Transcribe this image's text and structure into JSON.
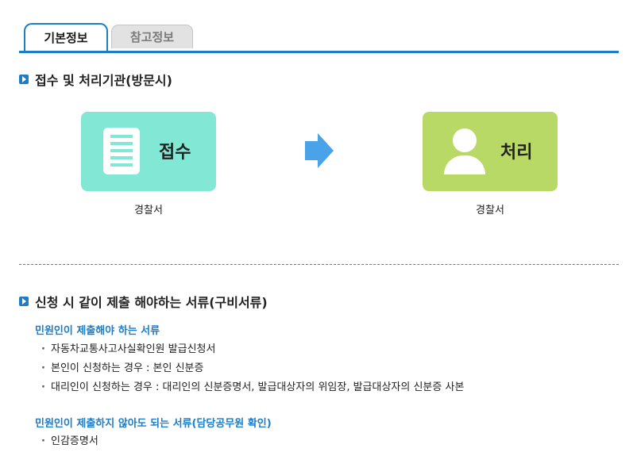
{
  "tabs": [
    {
      "label": "기본정보",
      "active": true
    },
    {
      "label": "참고정보",
      "active": false
    }
  ],
  "section_agency": {
    "title": "접수 및 처리기관(방문시)",
    "receive": {
      "label": "접수",
      "caption": "경찰서",
      "icon": "document-icon",
      "color": "#82e7d5"
    },
    "process": {
      "label": "처리",
      "caption": "경찰서",
      "icon": "person-icon",
      "color": "#b8d965"
    },
    "arrow": {
      "icon": "arrow-right-icon",
      "color": "#4aa3e8"
    }
  },
  "section_docs": {
    "title": "신청 시 같이 제출 해야하는 서류(구비서류)",
    "required": {
      "title": "민원인이 제출해야 하는 서류",
      "items": [
        "자동차교통사고사실확인원 발급신청서",
        "본인이 신청하는 경우 : 본인 신분증",
        "대리인이 신청하는 경우 : 대리인의 신분증명서, 발급대상자의 위임장, 발급대상자의 신분증 사본"
      ]
    },
    "not_required": {
      "title": "민원인이 제출하지 않아도 되는 서류(담당공무원 확인)",
      "items": [
        "인감증명서"
      ]
    }
  },
  "colors": {
    "accent": "#1d7dc5"
  }
}
